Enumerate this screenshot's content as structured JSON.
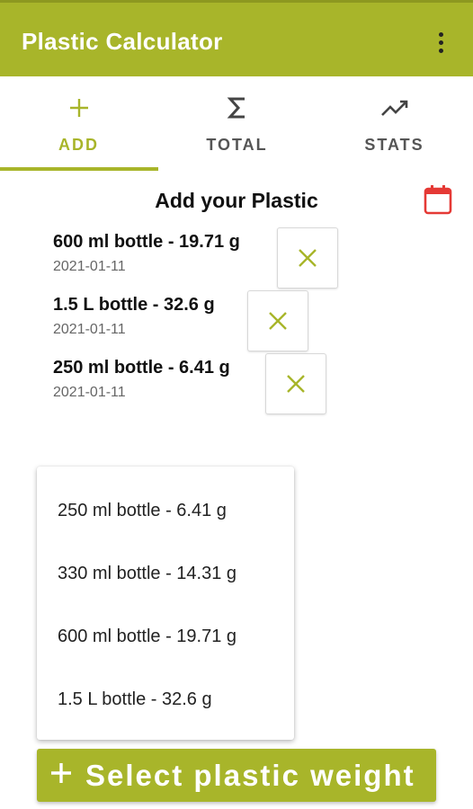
{
  "appbar": {
    "title": "Plastic Calculator",
    "overflow_icon": "more-vert-icon"
  },
  "tabs": [
    {
      "label": "ADD",
      "icon": "plus-icon",
      "active": true
    },
    {
      "label": "TOTAL",
      "icon": "sigma-icon",
      "active": false
    },
    {
      "label": "STATS",
      "icon": "trending-up-icon",
      "active": false
    }
  ],
  "section": {
    "title": "Add your Plastic",
    "calendar_icon": "calendar-icon"
  },
  "entries": [
    {
      "title": "600 ml bottle - 19.71 g",
      "date": "2021-01-11"
    },
    {
      "title": "1.5 L bottle - 32.6 g",
      "date": "2021-01-11"
    },
    {
      "title": "250 ml bottle - 6.41 g",
      "date": "2021-01-11"
    }
  ],
  "dropdown": {
    "options": [
      "250 ml bottle - 6.41 g",
      "330 ml bottle - 14.31 g",
      "600 ml bottle - 19.71 g",
      "1.5 L bottle - 32.6 g"
    ]
  },
  "fab": {
    "label": "Select plastic weight",
    "icon": "plus-icon"
  },
  "colors": {
    "accent": "#a8b52a",
    "calendar": "#e53935",
    "text": "#111111",
    "muted": "#666666"
  }
}
